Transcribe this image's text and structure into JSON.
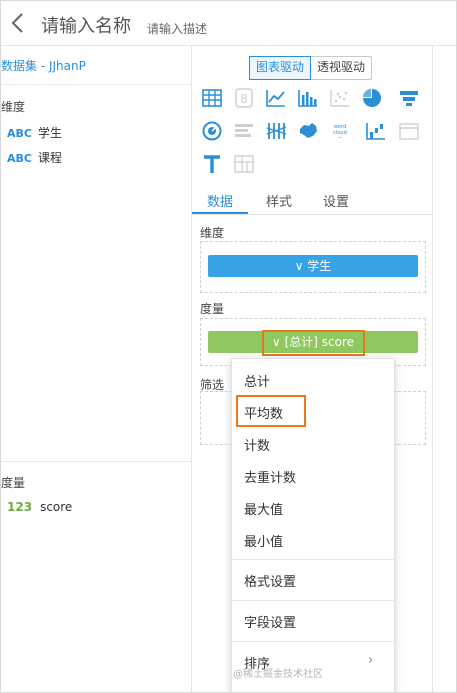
{
  "header": {
    "title": "请输入名称",
    "description": "请输入描述"
  },
  "left_panel": {
    "dataset": "数据集 - JJhanP",
    "dimension_label": "维度",
    "dimensions": [
      {
        "type": "ABC",
        "name": "学生"
      },
      {
        "type": "ABC",
        "name": "课程"
      }
    ],
    "measure_label": "度量",
    "measures": [
      {
        "type": "123",
        "name": "score"
      }
    ]
  },
  "right_panel": {
    "mode_buttons": [
      "图表驱动",
      "透视驱动"
    ],
    "active_mode": "图表驱动",
    "chart_icons": [
      "table-icon",
      "kpi-icon",
      "line-chart-icon",
      "bar-chart-icon",
      "scatter-icon",
      "pie-chart-icon",
      "funnel-icon",
      "gauge-icon",
      "horizontal-bar-icon",
      "parallel-icon",
      "china-map-icon",
      "word-cloud-icon",
      "waterfall-icon",
      "blank-icon",
      "text-icon",
      "treemap-icon"
    ],
    "tabs": [
      "数据",
      "样式",
      "设置"
    ],
    "active_tab": "数据",
    "dimension_section": "维度",
    "dimension_pill": "∨ 学生",
    "measure_section": "度量",
    "measure_pill": "∨ [总计] score",
    "filter_section": "筛选",
    "dimension_pill_color": "#36a3e6",
    "measure_pill_color": "#8fc85e",
    "highlight_color": "#e87722"
  },
  "dropdown": {
    "items": [
      "总计",
      "平均数",
      "计数",
      "去重计数",
      "最大值",
      "最小值"
    ],
    "highlighted": "平均数",
    "format_settings": "格式设置",
    "field_settings": "字段设置",
    "sort": "排序",
    "sort_arrow": "›"
  },
  "watermark": "@稀土掘金技术社区"
}
